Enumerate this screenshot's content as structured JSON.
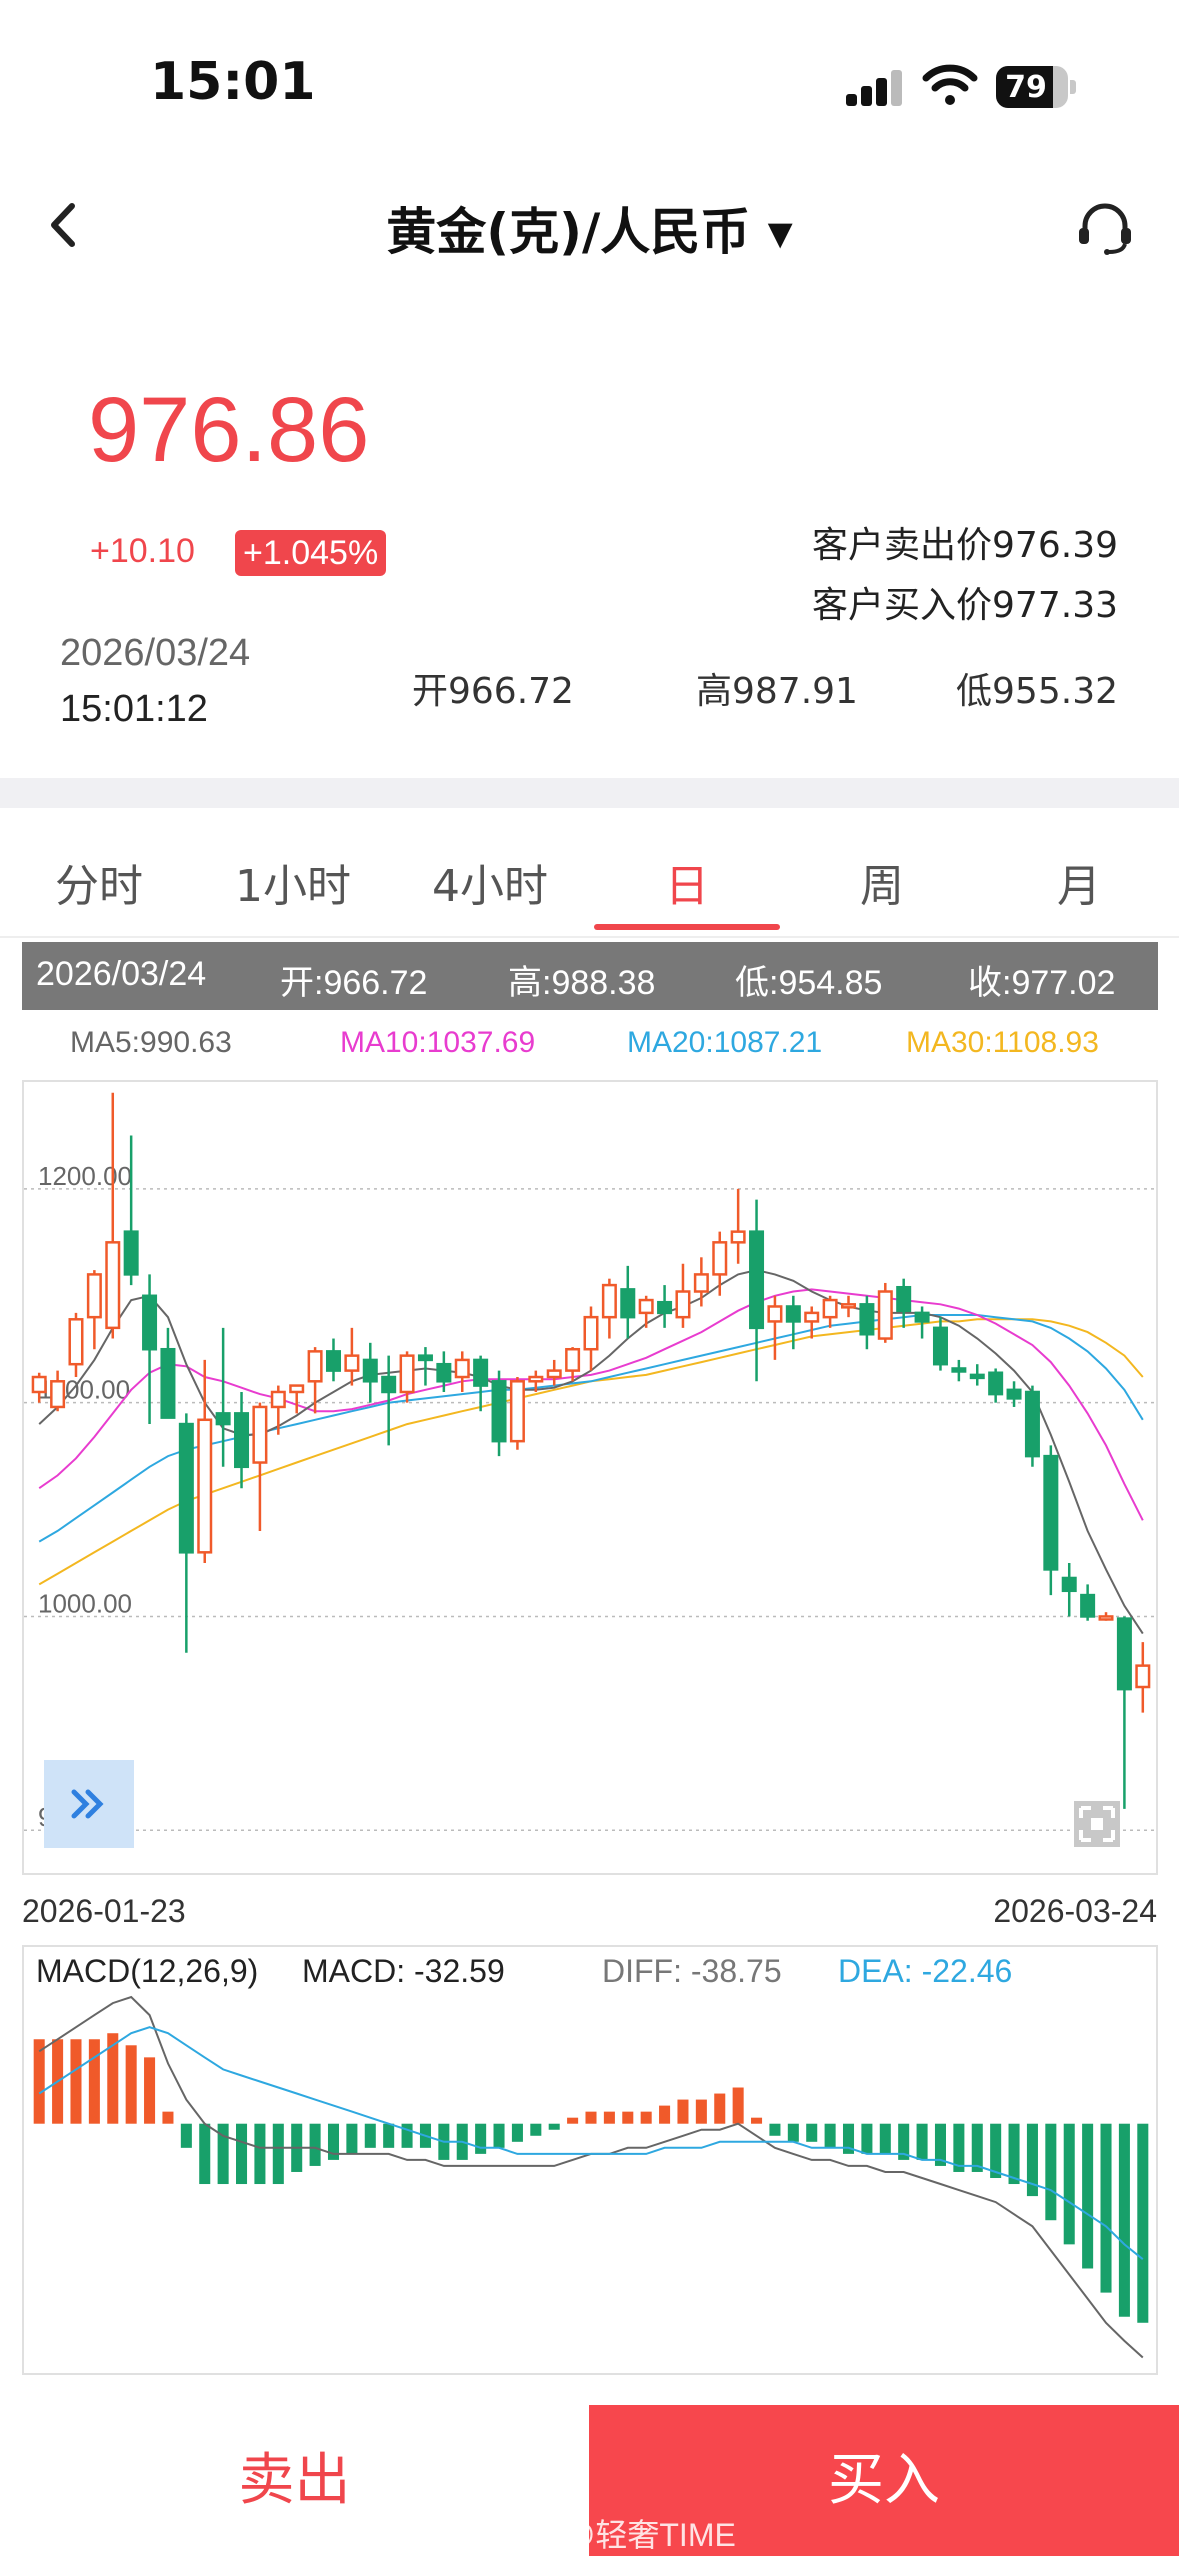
{
  "status_bar": {
    "time": "15:01",
    "battery": "79",
    "battery_level": 0.79
  },
  "header": {
    "title": "黄金(克)/人民币 ▾"
  },
  "quote": {
    "price": "976.86",
    "change": "+10.10",
    "change_pct": "+1.045%",
    "sell_price": "客户卖出价976.39",
    "buy_price": "客户买入价977.33",
    "date": "2026/03/24",
    "time": "15:01:12",
    "open": "开966.72",
    "high": "高987.91",
    "low": "低955.32"
  },
  "tabs": [
    "分时",
    "1小时",
    "4小时",
    "日",
    "周",
    "月"
  ],
  "active_tab": "日",
  "info_bar": {
    "date": "2026/03/24",
    "open": "开:966.72",
    "high": "高:988.38",
    "low": "低:954.85",
    "close": "收:977.02"
  },
  "ma": {
    "ma5": "MA5:990.63",
    "ma10": "MA10:1037.69",
    "ma20": "MA20:1087.21",
    "ma30": "MA30:1108.93"
  },
  "colors": {
    "up": "#f05a2a",
    "down": "#18a06a",
    "accent": "#f0464c",
    "ma5": "#666666",
    "ma10": "#e83ccf",
    "ma20": "#2ea8e0",
    "ma30": "#f3b720"
  },
  "axis": {
    "date_start": "2026-01-23",
    "date_end": "2026-03-24"
  },
  "macd": {
    "label": "MACD(12,26,9)",
    "macd": "MACD: -32.59",
    "diff": "DIFF: -38.75",
    "dea": "DEA: -22.46"
  },
  "actions": {
    "sell": "卖出",
    "buy": "买入"
  },
  "watermark": "微博 @轻奢TIME",
  "chart_data": [
    {
      "type": "candlestick",
      "title": "",
      "y_ticks": [
        "1200.00",
        "1100.00",
        "1000.00",
        "900.00"
      ],
      "ylim": [
        880,
        1250
      ],
      "candles": [
        [
          1105,
          1112,
          1100,
          1114
        ],
        [
          1098,
          1110,
          1096,
          1115
        ],
        [
          1118,
          1139,
          1112,
          1142
        ],
        [
          1140,
          1160,
          1125,
          1162
        ],
        [
          1135,
          1175,
          1130,
          1245
        ],
        [
          1180,
          1160,
          1155,
          1225
        ],
        [
          1150,
          1125,
          1090,
          1160
        ],
        [
          1125,
          1093,
          1093,
          1135
        ],
        [
          1090,
          1030,
          983,
          1095
        ],
        [
          1030,
          1092,
          1025,
          1120
        ],
        [
          1095,
          1090,
          1070,
          1135
        ],
        [
          1095,
          1070,
          1060,
          1105
        ],
        [
          1072,
          1098,
          1040,
          1100
        ],
        [
          1098,
          1105,
          1085,
          1108
        ],
        [
          1105,
          1108,
          1095,
          1108
        ],
        [
          1110,
          1124,
          1095,
          1126
        ],
        [
          1124,
          1115,
          1110,
          1130
        ],
        [
          1115,
          1122,
          1108,
          1135
        ],
        [
          1120,
          1110,
          1100,
          1128
        ],
        [
          1112,
          1105,
          1080,
          1122
        ],
        [
          1105,
          1122,
          1100,
          1124
        ],
        [
          1122,
          1120,
          1108,
          1126
        ],
        [
          1118,
          1110,
          1105,
          1124
        ],
        [
          1112,
          1120,
          1105,
          1124
        ],
        [
          1120,
          1108,
          1096,
          1122
        ],
        [
          1110,
          1082,
          1075,
          1115
        ],
        [
          1082,
          1110,
          1078,
          1112
        ],
        [
          1110,
          1112,
          1105,
          1115
        ],
        [
          1112,
          1115,
          1108,
          1120
        ],
        [
          1115,
          1125,
          1110,
          1126
        ],
        [
          1125,
          1140,
          1115,
          1145
        ],
        [
          1140,
          1155,
          1130,
          1158
        ],
        [
          1153,
          1140,
          1130,
          1164
        ],
        [
          1142,
          1148,
          1135,
          1150
        ],
        [
          1147,
          1142,
          1135,
          1155
        ],
        [
          1140,
          1152,
          1135,
          1165
        ],
        [
          1152,
          1160,
          1145,
          1168
        ],
        [
          1160,
          1175,
          1150,
          1180
        ],
        [
          1175,
          1180,
          1165,
          1200
        ],
        [
          1180,
          1135,
          1110,
          1195
        ],
        [
          1138,
          1145,
          1120,
          1150
        ],
        [
          1145,
          1138,
          1125,
          1150
        ],
        [
          1138,
          1142,
          1130,
          1145
        ],
        [
          1140,
          1148,
          1135,
          1150
        ],
        [
          1146,
          1146,
          1140,
          1150
        ],
        [
          1146,
          1132,
          1125,
          1150
        ],
        [
          1130,
          1152,
          1128,
          1156
        ],
        [
          1154,
          1143,
          1135,
          1158
        ],
        [
          1142,
          1138,
          1130,
          1145
        ],
        [
          1135,
          1118,
          1115,
          1140
        ],
        [
          1116,
          1115,
          1110,
          1120
        ],
        [
          1113,
          1112,
          1108,
          1118
        ],
        [
          1114,
          1104,
          1100,
          1116
        ],
        [
          1106,
          1102,
          1098,
          1110
        ],
        [
          1105,
          1075,
          1070,
          1108
        ],
        [
          1075,
          1022,
          1010,
          1080
        ],
        [
          1018,
          1012,
          1000,
          1025
        ],
        [
          1010,
          1000,
          998,
          1015
        ],
        [
          1000,
          1000,
          998,
          1002
        ],
        [
          999,
          966,
          910,
          1000
        ],
        [
          967,
          977,
          955,
          988
        ]
      ],
      "series": [
        {
          "name": "MA5",
          "values": [
            1090,
            1098,
            1108,
            1120,
            1135,
            1148,
            1150,
            1140,
            1118,
            1100,
            1088,
            1085,
            1085,
            1089,
            1094,
            1100,
            1105,
            1110,
            1113,
            1114,
            1115,
            1116,
            1115,
            1114,
            1112,
            1108,
            1106,
            1106,
            1107,
            1110,
            1115,
            1122,
            1130,
            1137,
            1142,
            1145,
            1149,
            1155,
            1160,
            1162,
            1160,
            1157,
            1152,
            1148,
            1145,
            1143,
            1142,
            1142,
            1142,
            1140,
            1136,
            1130,
            1123,
            1115,
            1105,
            1085,
            1063,
            1040,
            1022,
            1005,
            992
          ]
        },
        {
          "name": "MA10",
          "values": [
            1060,
            1066,
            1074,
            1084,
            1095,
            1106,
            1114,
            1118,
            1117,
            1112,
            1110,
            1107,
            1104,
            1102,
            1099,
            1096,
            1096,
            1097,
            1099,
            1101,
            1104,
            1106,
            1108,
            1110,
            1111,
            1111,
            1111,
            1111,
            1111,
            1112,
            1113,
            1115,
            1118,
            1121,
            1125,
            1129,
            1133,
            1138,
            1143,
            1147,
            1150,
            1152,
            1153,
            1152,
            1151,
            1150,
            1149,
            1148,
            1147,
            1146,
            1144,
            1141,
            1137,
            1132,
            1127,
            1119,
            1108,
            1095,
            1080,
            1062,
            1045
          ]
        },
        {
          "name": "MA20",
          "values": [
            1035,
            1040,
            1046,
            1052,
            1058,
            1064,
            1070,
            1075,
            1078,
            1080,
            1082,
            1084,
            1086,
            1088,
            1090,
            1092,
            1094,
            1096,
            1098,
            1100,
            1101,
            1102,
            1103,
            1104,
            1105,
            1106,
            1106,
            1107,
            1108,
            1109,
            1110,
            1112,
            1114,
            1116,
            1118,
            1120,
            1122,
            1124,
            1126,
            1128,
            1130,
            1132,
            1134,
            1136,
            1137,
            1138,
            1139,
            1140,
            1141,
            1141,
            1141,
            1141,
            1140,
            1139,
            1138,
            1135,
            1130,
            1124,
            1116,
            1106,
            1092
          ]
        },
        {
          "name": "MA30",
          "values": [
            1015,
            1020,
            1025,
            1030,
            1035,
            1040,
            1045,
            1050,
            1054,
            1057,
            1060,
            1063,
            1066,
            1069,
            1072,
            1075,
            1078,
            1081,
            1084,
            1087,
            1090,
            1092,
            1094,
            1096,
            1098,
            1100,
            1102,
            1104,
            1106,
            1108,
            1110,
            1111,
            1112,
            1113,
            1115,
            1117,
            1119,
            1121,
            1123,
            1125,
            1127,
            1129,
            1131,
            1132,
            1133,
            1134,
            1135,
            1136,
            1137,
            1138,
            1138,
            1139,
            1139,
            1139,
            1139,
            1138,
            1136,
            1133,
            1128,
            1122,
            1112
          ]
        }
      ]
    },
    {
      "type": "bar",
      "title": "MACD(12,26,9)",
      "ylim": [
        -40,
        22
      ],
      "values": [
        14,
        14,
        14,
        14,
        15,
        13,
        11,
        2,
        -4,
        -10,
        -10,
        -10,
        -10,
        -10,
        -8,
        -7,
        -6,
        -5,
        -4,
        -4,
        -4,
        -4,
        -6,
        -6,
        -5,
        -4,
        -3,
        -2,
        -1,
        1,
        2,
        2,
        2,
        2,
        3,
        4,
        4,
        5,
        6,
        1,
        -2,
        -3,
        -3,
        -4,
        -5,
        -5,
        -5,
        -6,
        -6,
        -7,
        -8,
        -8,
        -9,
        -10,
        -12,
        -16,
        -20,
        -24,
        -28,
        -32,
        -33
      ],
      "series": [
        {
          "name": "DIFF",
          "values": [
            12,
            14,
            16,
            18,
            20,
            21,
            18,
            10,
            4,
            0,
            -2,
            -3,
            -4,
            -4,
            -4,
            -4,
            -5,
            -5,
            -5,
            -5,
            -6,
            -6,
            -7,
            -7,
            -7,
            -7,
            -7,
            -7,
            -7,
            -6,
            -5,
            -5,
            -4,
            -4,
            -3,
            -2,
            -1,
            -1,
            0,
            -2,
            -4,
            -5,
            -6,
            -6,
            -7,
            -7,
            -8,
            -8,
            -9,
            -10,
            -11,
            -12,
            -13,
            -15,
            -17,
            -21,
            -25,
            -29,
            -33,
            -36,
            -38.75
          ]
        },
        {
          "name": "DEA",
          "values": [
            5,
            7,
            9,
            11,
            13,
            15,
            16,
            15,
            13,
            11,
            9,
            8,
            7,
            6,
            5,
            4,
            3,
            2,
            1,
            0,
            -1,
            -2,
            -3,
            -3,
            -4,
            -4,
            -5,
            -5,
            -5,
            -5,
            -5,
            -5,
            -5,
            -5,
            -4,
            -4,
            -4,
            -3,
            -3,
            -3,
            -3,
            -3,
            -4,
            -4,
            -4,
            -5,
            -5,
            -5,
            -6,
            -6,
            -7,
            -7,
            -8,
            -9,
            -10,
            -11,
            -13,
            -15,
            -17,
            -20,
            -22.46
          ]
        }
      ]
    }
  ]
}
